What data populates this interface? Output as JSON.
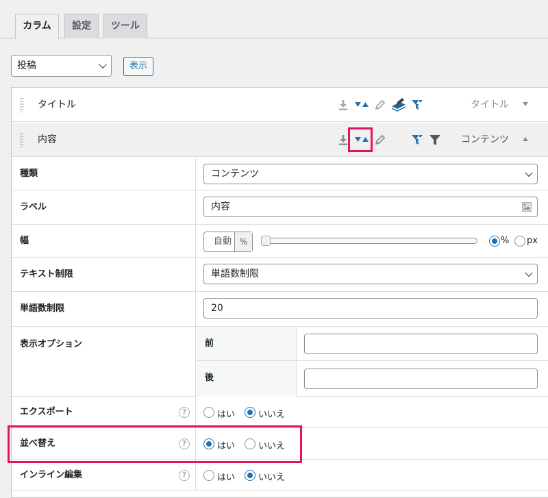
{
  "tabs": [
    {
      "label": "カラム",
      "active": true
    },
    {
      "label": "設定",
      "active": false
    },
    {
      "label": "ツール",
      "active": false
    }
  ],
  "post_type_select": {
    "value": "投稿"
  },
  "show_button": {
    "label": "表示"
  },
  "columns": [
    {
      "label": "タイトル",
      "type": "タイトル",
      "expanded": false
    },
    {
      "label": "内容",
      "type": "コンテンツ",
      "expanded": true
    }
  ],
  "column_icons": [
    "download-icon",
    "sort-icon",
    "edit-icon",
    "bulk-edit-icon",
    "smart-filter-icon",
    "filter-icon"
  ],
  "settings": {
    "type": {
      "label": "種類",
      "value": "コンテンツ"
    },
    "label": {
      "label": "ラベル",
      "value": "内容"
    },
    "width": {
      "label": "幅",
      "value": "自動",
      "unit": "%",
      "slider_fraction": 0.0,
      "unit_options": [
        "%",
        "px"
      ],
      "selected_unit": "%"
    },
    "text_limit": {
      "label": "テキスト制限",
      "value": "単語数制限"
    },
    "word_limit": {
      "label": "単語数制限",
      "value": "20"
    },
    "display_options": {
      "label": "表示オプション",
      "before_label": "前",
      "after_label": "後",
      "before_value": "",
      "after_value": ""
    },
    "export": {
      "label": "エクスポート",
      "yes": "はい",
      "no": "いいえ",
      "selected": "no"
    },
    "sorting": {
      "label": "並べ替え",
      "yes": "はい",
      "no": "いいえ",
      "selected": "yes"
    },
    "inline_edit": {
      "label": "インライン編集",
      "yes": "はい",
      "no": "いいえ",
      "selected": "no"
    }
  },
  "colors": {
    "accent": "#2271b1",
    "highlight": "#e5135f",
    "icon_active": "#2271b1",
    "icon_muted": "#8c8f94"
  }
}
